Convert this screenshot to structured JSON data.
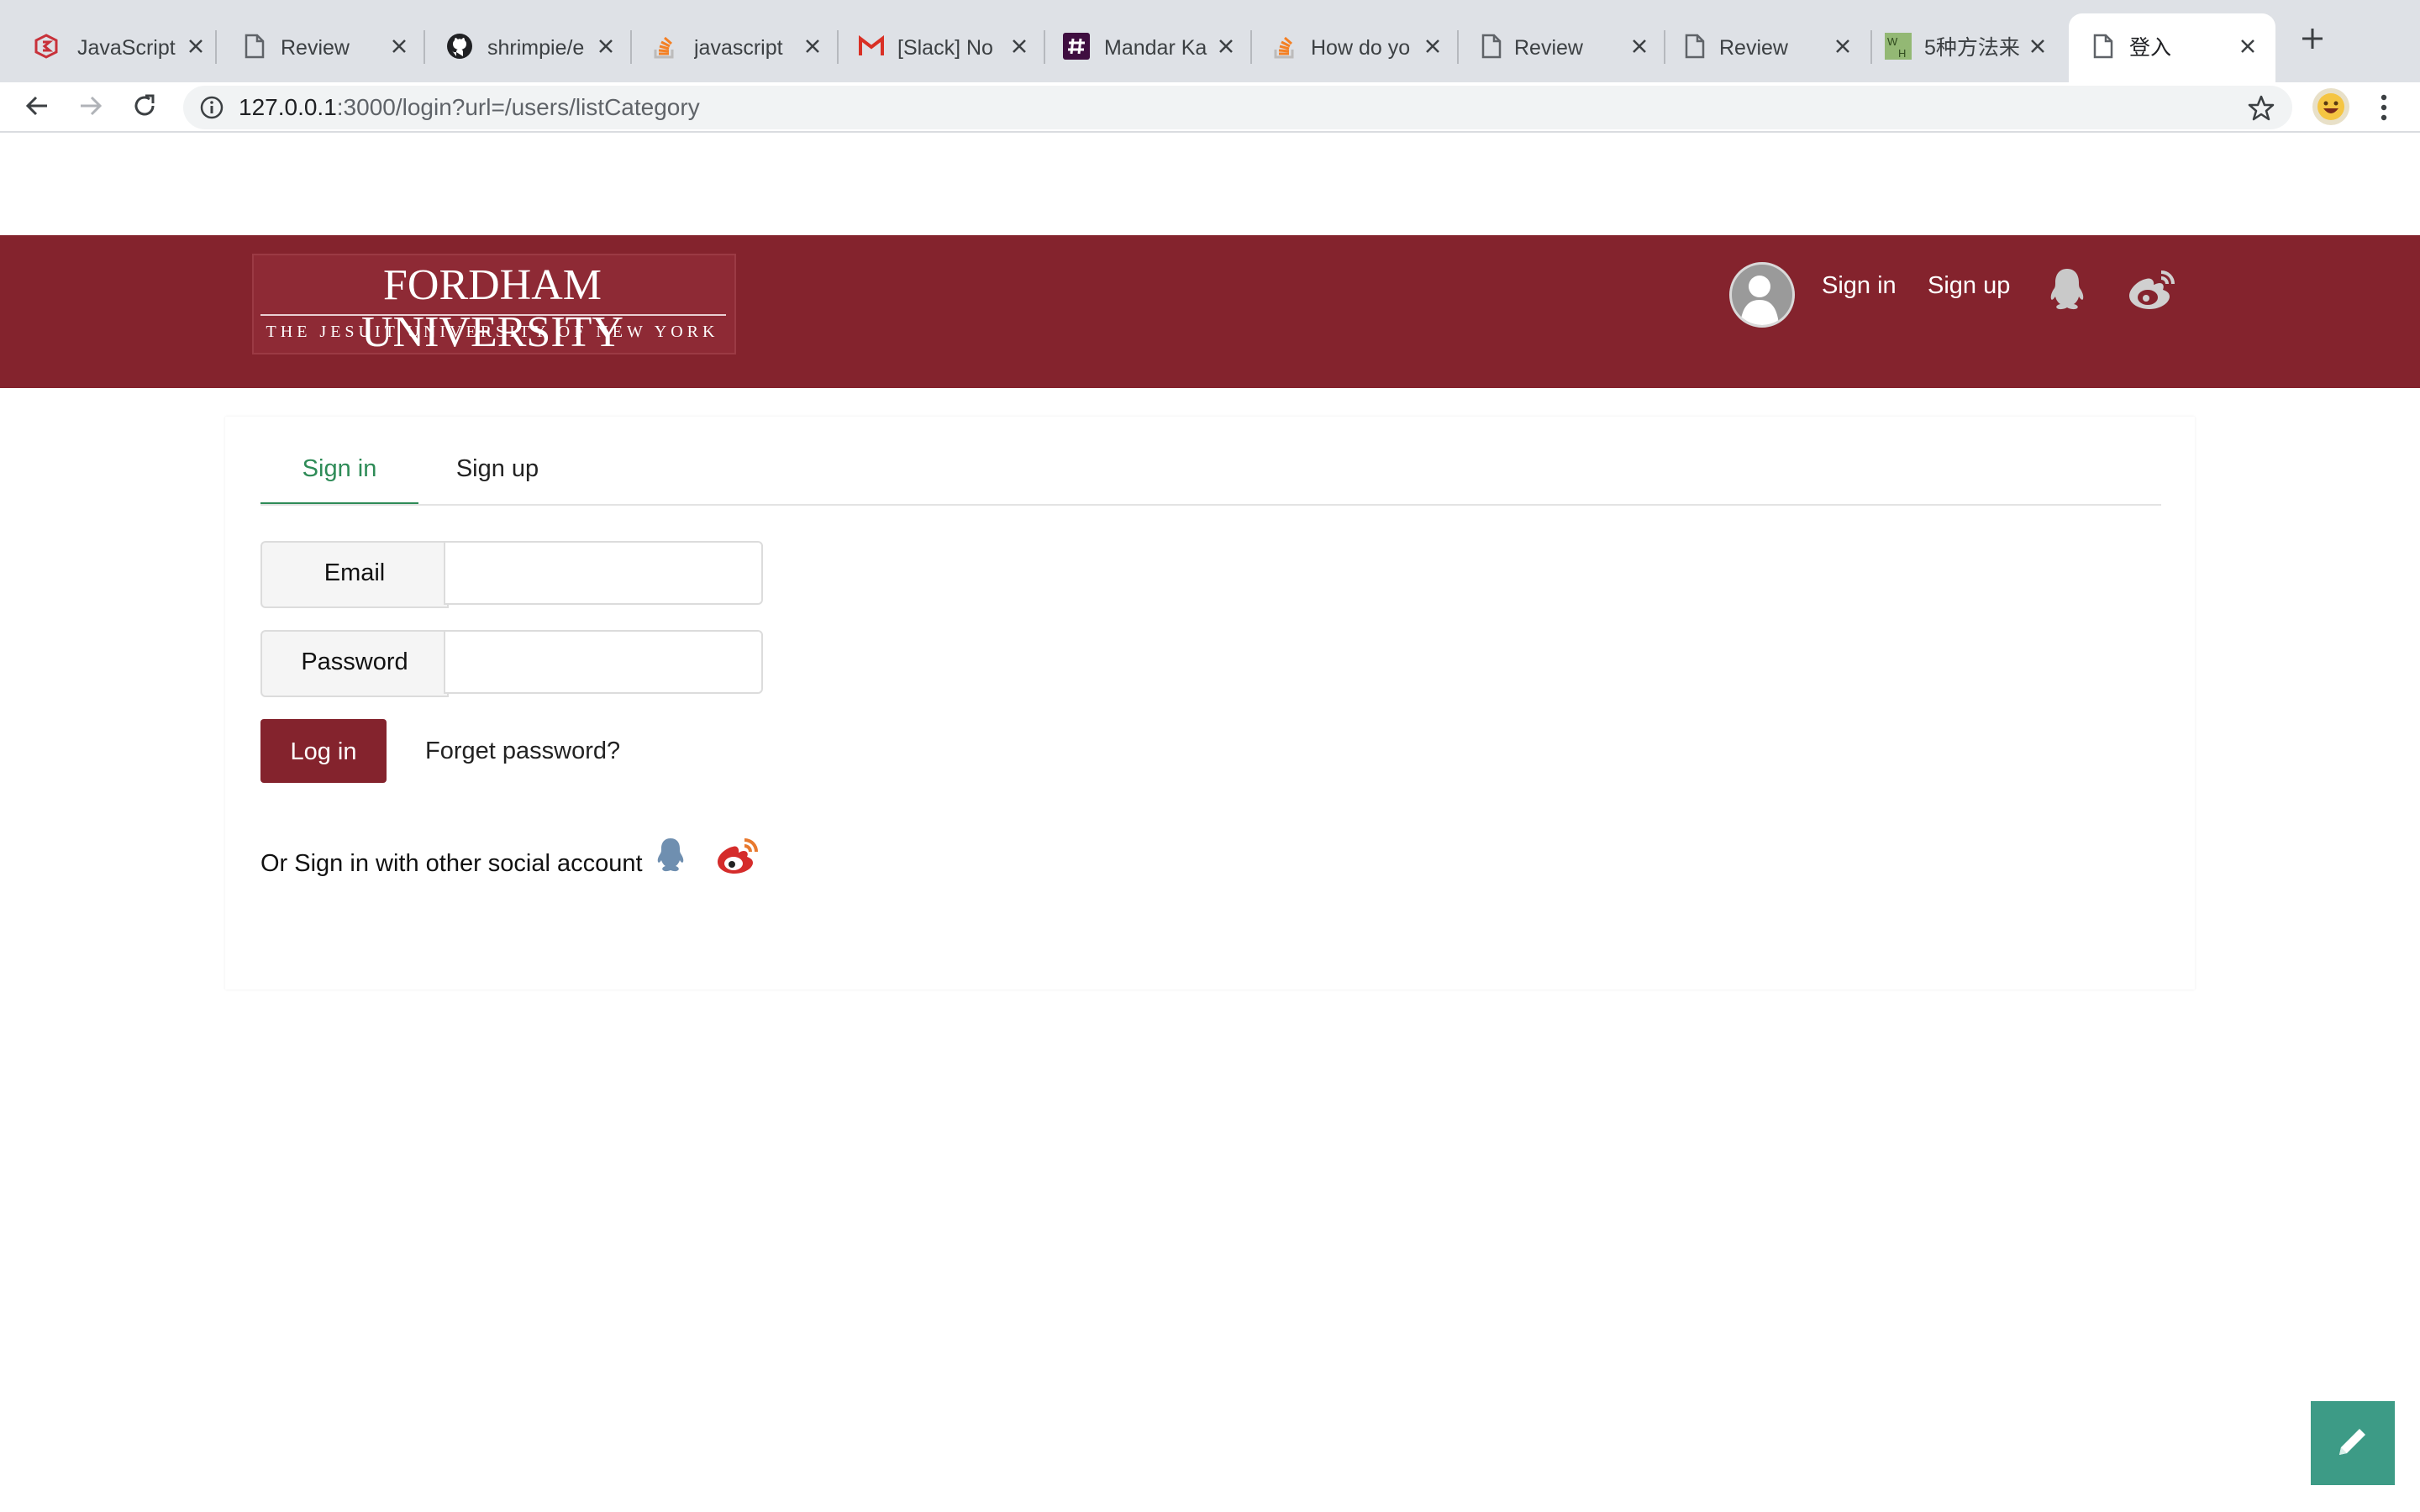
{
  "browser": {
    "tabs": [
      {
        "label": "JavaScript",
        "icon": "js-tutorial-icon"
      },
      {
        "label": "Review",
        "icon": "document-icon"
      },
      {
        "label": "shrimpie/e",
        "icon": "github-icon"
      },
      {
        "label": "javascript",
        "icon": "stackoverflow-icon"
      },
      {
        "label": "[Slack] No",
        "icon": "gmail-icon"
      },
      {
        "label": "Mandar Ka",
        "icon": "slack-icon"
      },
      {
        "label": "How do yo",
        "icon": "stackoverflow-icon"
      },
      {
        "label": "Review",
        "icon": "document-icon"
      },
      {
        "label": "Review",
        "icon": "document-icon"
      },
      {
        "label": "5种方法来",
        "icon": "wikihow-icon"
      },
      {
        "label": "登入",
        "icon": "document-icon"
      }
    ],
    "address": {
      "host": "127.0.0.1",
      "rest": ":3000/login?url=/users/listCategory"
    }
  },
  "header": {
    "logo": {
      "line1": "FORDHAM UNIVERSITY",
      "line2": "THE JESUIT UNIVERSITY OF NEW YORK"
    },
    "signin": "Sign in",
    "signup": "Sign up"
  },
  "login": {
    "tabs": {
      "signin": "Sign in",
      "signup": "Sign up"
    },
    "email": {
      "label": "Email",
      "value": "",
      "placeholder": ""
    },
    "password": {
      "label": "Password",
      "value": "",
      "placeholder": ""
    },
    "login_button": "Log in",
    "forgot": "Forget password?",
    "social_text": "Or Sign in with other social account"
  },
  "colors": {
    "brand": "#84232d",
    "active_tab": "#2e8b57",
    "fab": "#3d9b86",
    "weibo": "#d52c2b",
    "qq": "#6f8fb0"
  }
}
